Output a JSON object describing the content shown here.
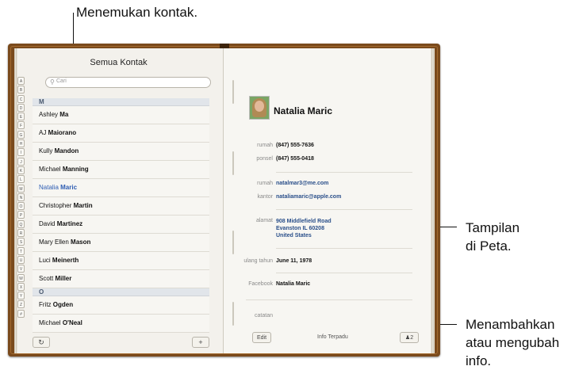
{
  "callouts": {
    "find_contacts": "Menemukan kontak.",
    "map_view_1": "Tampilan",
    "map_view_2": "di Peta.",
    "edit_1": "Menambahkan",
    "edit_2": "atau mengubah",
    "edit_3": "info."
  },
  "left_page": {
    "title": "Semua Kontak",
    "search_placeholder": "Cari",
    "index": [
      "A",
      "B",
      "C",
      "D",
      "E",
      "F",
      "G",
      "H",
      "I",
      "J",
      "K",
      "L",
      "M",
      "N",
      "O",
      "P",
      "Q",
      "R",
      "S",
      "T",
      "U",
      "V",
      "W",
      "X",
      "Y",
      "Z",
      "#"
    ],
    "sections": [
      {
        "header": "M",
        "rows": [
          {
            "first": "Ashley",
            "last": "Ma"
          },
          {
            "first": "AJ",
            "last": "Maiorano"
          },
          {
            "first": "Kully",
            "last": "Mandon"
          },
          {
            "first": "Michael",
            "last": "Manning"
          },
          {
            "first": "Natalia",
            "last": "Maric",
            "selected": true
          },
          {
            "first": "Christopher",
            "last": "Martin"
          },
          {
            "first": "David",
            "last": "Martinez"
          },
          {
            "first": "Mary Ellen",
            "last": "Mason"
          },
          {
            "first": "Luci",
            "last": "Meinerth"
          },
          {
            "first": "Scott",
            "last": "Miller"
          }
        ]
      },
      {
        "header": "O",
        "rows": [
          {
            "first": "Fritz",
            "last": "Ogden"
          },
          {
            "first": "Michael",
            "last": "O'Neal"
          }
        ]
      }
    ],
    "refresh_icon": "↻",
    "add_label": "+"
  },
  "contact": {
    "name": "Natalia Maric",
    "fields": {
      "home_phone_label": "rumah",
      "home_phone": "(847) 555-7636",
      "mobile_label": "ponsel",
      "mobile": "(847) 555-0418",
      "home_email_label": "rumah",
      "home_email": "natalmar3@me.com",
      "work_email_label": "kantor",
      "work_email": "nataliamaric@apple.com",
      "address_label": "alamat",
      "address_1": "908 Middlefield Road",
      "address_2": "Evanston IL 60208",
      "address_3": "United States",
      "birthday_label": "ulang tahun",
      "birthday": "June 11, 1978",
      "facebook_label": "Facebook",
      "facebook": "Natalia Maric",
      "notes_label": "catatan"
    },
    "edit_label": "Edit",
    "unified_info_label": "Info Terpadu",
    "linked_count": "2",
    "person_icon": "person-icon"
  }
}
